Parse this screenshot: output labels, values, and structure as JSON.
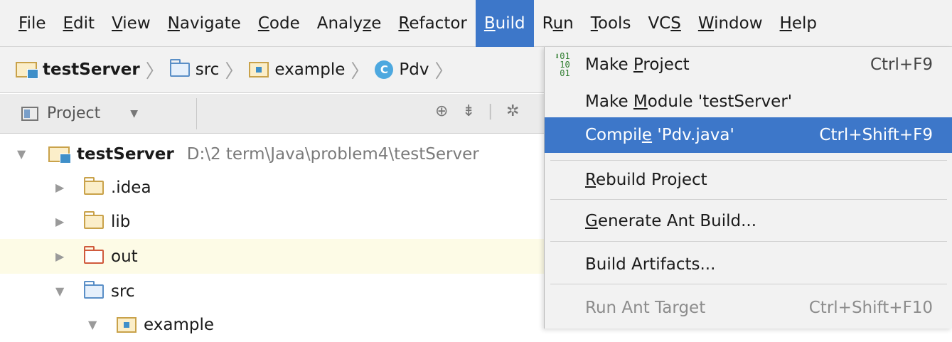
{
  "menubar": {
    "items": [
      {
        "label": "File",
        "ul": "F",
        "rest": "ile"
      },
      {
        "label": "Edit",
        "ul": "E",
        "rest": "dit"
      },
      {
        "label": "View",
        "ul": "V",
        "rest": "iew"
      },
      {
        "label": "Navigate",
        "ul": "N",
        "rest": "avigate"
      },
      {
        "label": "Code",
        "ul": "C",
        "rest": "ode"
      },
      {
        "label": "Analyze",
        "pre": "Analy",
        "ul": "z",
        "rest": "e"
      },
      {
        "label": "Refactor",
        "ul": "R",
        "rest": "efactor"
      },
      {
        "label": "Build",
        "ul": "B",
        "rest": "uild"
      },
      {
        "label": "Run",
        "pre": "R",
        "ul": "u",
        "rest": "n"
      },
      {
        "label": "Tools",
        "ul": "T",
        "rest": "ools"
      },
      {
        "label": "VCS",
        "pre": "VC",
        "ul": "S",
        "rest": ""
      },
      {
        "label": "Window",
        "ul": "W",
        "rest": "indow"
      },
      {
        "label": "Help",
        "ul": "H",
        "rest": "elp"
      }
    ]
  },
  "breadcrumb": {
    "project": "testServer",
    "src": "src",
    "package": "example",
    "class": "Pdv",
    "class_badge": "C"
  },
  "project_panel": {
    "label": "Project"
  },
  "tree": {
    "root_name": "testServer",
    "root_path": "D:\\2 term\\Java\\problem4\\testServer",
    "idea": ".idea",
    "lib": "lib",
    "out": "out",
    "src": "src",
    "example": "example"
  },
  "build_menu": {
    "make_project": {
      "pre": "Make ",
      "ul": "P",
      "rest": "roject",
      "shortcut": "Ctrl+F9"
    },
    "make_module": {
      "pre": "Make ",
      "ul": "M",
      "rest": "odule 'testServer'"
    },
    "compile": {
      "pre": "Compil",
      "ul": "e",
      "rest": " 'Pdv.java'",
      "shortcut": "Ctrl+Shift+F9"
    },
    "rebuild": {
      "pre": "",
      "ul": "R",
      "rest": "ebuild Project"
    },
    "generate_ant": {
      "pre": "",
      "ul": "G",
      "rest": "enerate Ant Build..."
    },
    "build_artifacts": {
      "label": "Build Artifacts..."
    },
    "run_ant_target": {
      "label": "Run Ant Target",
      "shortcut": "Ctrl+Shift+F10"
    },
    "make_icon_text": "01\n10\n01"
  },
  "colors": {
    "selection": "#3d77c9",
    "menu_bg": "#f2f2f2",
    "highlight_row": "#fdfbe6"
  }
}
